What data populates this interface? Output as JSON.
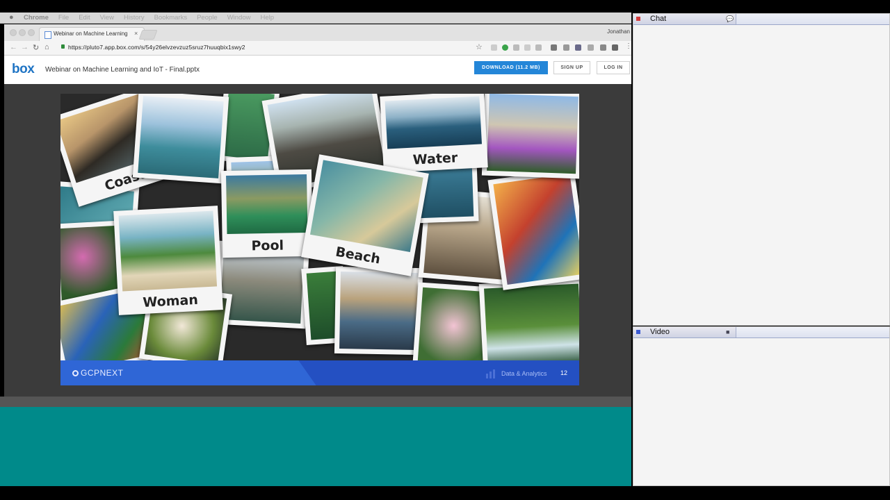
{
  "menubar": {
    "items": [
      "Chrome",
      "File",
      "Edit",
      "View",
      "History",
      "Bookmarks",
      "People",
      "Window",
      "Help"
    ]
  },
  "browser": {
    "tab_title": "Webinar on Machine Learning",
    "tab_close": "×",
    "user": "Jonathan",
    "url": "https://pluto7.app.box.com/s/54y26elvzevzuz5sruz7huuqbix1swy2"
  },
  "box": {
    "logo": "box",
    "filename": "Webinar on Machine Learning and IoT - Final.pptx",
    "download_label": "DOWNLOAD (11.2 MB)",
    "signup_label": "SIGN UP",
    "login_label": "LOG IN"
  },
  "slide": {
    "captions": [
      "Coast",
      "Water",
      "Pool",
      "Beach",
      "Woman"
    ],
    "footer_brand": "GCPNEXT",
    "footer_section": "Data & Analytics",
    "page_number": "12"
  },
  "panels": {
    "chat_title": "Chat",
    "video_title": "Video"
  }
}
